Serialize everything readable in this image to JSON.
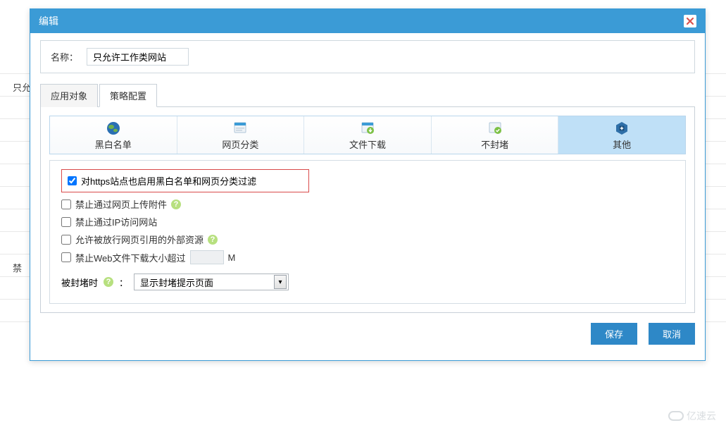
{
  "modal": {
    "title": "编辑",
    "name_label": "名称：",
    "name_value": "只允许工作类网站"
  },
  "tabs": [
    {
      "id": "apply",
      "label": "应用对象",
      "active": false
    },
    {
      "id": "policy",
      "label": "策略配置",
      "active": true
    }
  ],
  "sub_tabs": [
    {
      "id": "bwlist",
      "label": "黑白名单",
      "icon": "globe-icon"
    },
    {
      "id": "webcat",
      "label": "网页分类",
      "icon": "page-icon"
    },
    {
      "id": "filedl",
      "label": "文件下载",
      "icon": "download-icon"
    },
    {
      "id": "noblock",
      "label": "不封堵",
      "icon": "shield-icon"
    },
    {
      "id": "other",
      "label": "其他",
      "icon": "plus-box-icon",
      "active": true
    }
  ],
  "options": {
    "https_filter": {
      "label": "对https站点也启用黑白名单和网页分类过滤",
      "checked": true
    },
    "no_upload": {
      "label": "禁止通过网页上传附件",
      "checked": false
    },
    "no_ip": {
      "label": "禁止通过IP访问网站",
      "checked": false
    },
    "allow_ext": {
      "label": "允许被放行网页引用的外部资源",
      "checked": false
    },
    "web_limit": {
      "label": "禁止Web文件下载大小超过",
      "unit": "M",
      "checked": false,
      "value": ""
    }
  },
  "block": {
    "label": "被封堵时",
    "colon": "：",
    "selected": "显示封堵提示页面"
  },
  "actions": {
    "save": "保存",
    "cancel": "取消"
  },
  "background": {
    "col1": "只允",
    "col2": "禁"
  },
  "watermark": "亿速云"
}
